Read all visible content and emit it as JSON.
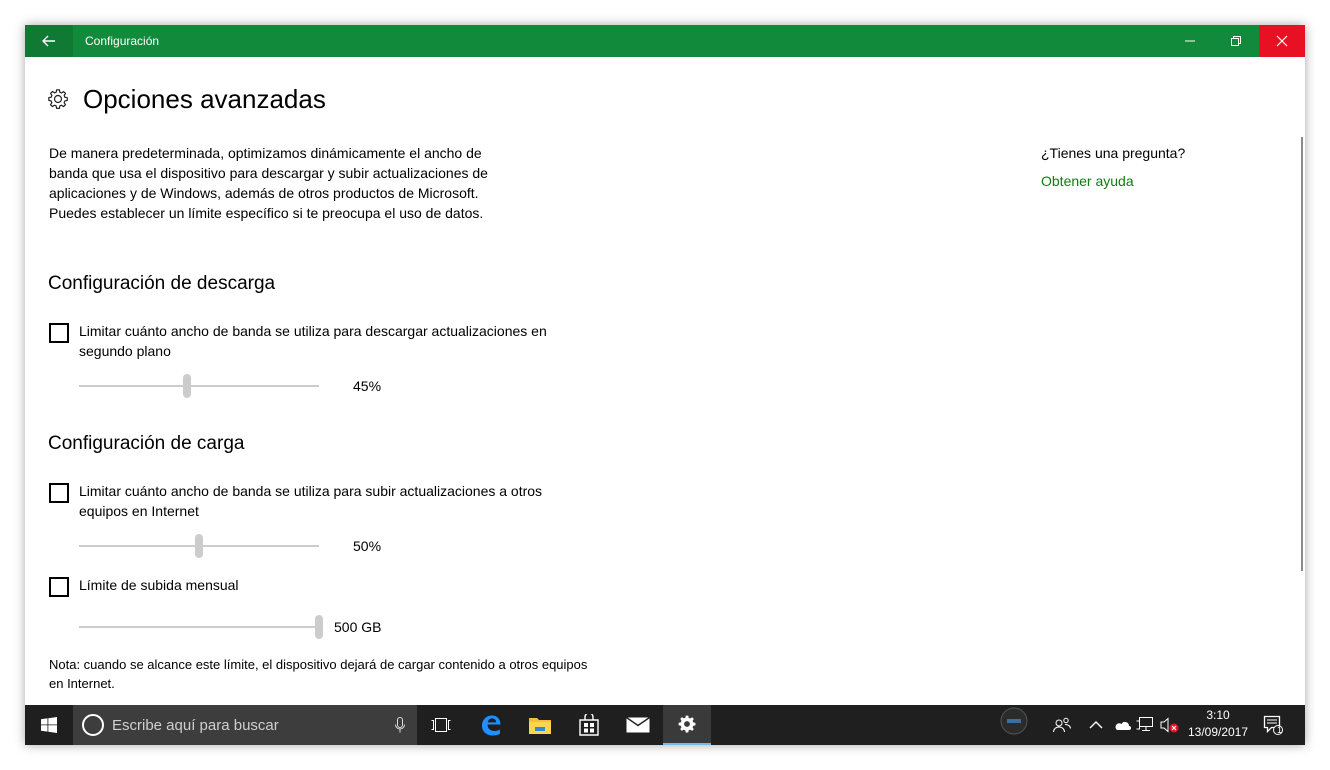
{
  "window": {
    "title": "Configuración",
    "accent_color": "#118a3c",
    "close_color": "#e81123"
  },
  "page": {
    "title": "Opciones avanzadas",
    "intro": "De manera predeterminada, optimizamos dinámicamente el ancho de banda que usa el dispositivo para descargar y subir actualizaciones de aplicaciones y de Windows, además de otros productos de Microsoft. Puedes establecer un límite específico si te preocupa el uso de datos."
  },
  "download": {
    "section_title": "Configuración de descarga",
    "checkbox_label": "Limitar cuánto ancho de banda se utiliza para descargar actualizaciones en segundo plano",
    "checked": false,
    "slider_value": "45%",
    "slider_fraction": 0.45
  },
  "upload": {
    "section_title": "Configuración de carga",
    "checkbox_label": "Limitar cuánto ancho de banda se utiliza para subir actualizaciones a otros equipos en Internet",
    "checked": false,
    "slider_value": "50%",
    "slider_fraction": 0.5,
    "monthly_label": "Límite de subida mensual",
    "monthly_checked": false,
    "monthly_value": "500 GB",
    "monthly_fraction": 1.0,
    "note": "Nota: cuando se alcance este límite, el dispositivo dejará de cargar contenido a otros equipos en Internet."
  },
  "sidebar": {
    "question": "¿Tienes una pregunta?",
    "help_link": "Obtener ayuda",
    "link_color": "#107c10"
  },
  "taskbar": {
    "search_placeholder": "Escribe aquí para buscar",
    "time": "3:10",
    "date": "13/09/2017",
    "notification_count": "1",
    "icons": [
      "windows-start-icon",
      "cortana-icon",
      "microphone-icon",
      "task-view-icon",
      "edge-icon",
      "file-explorer-icon",
      "store-icon",
      "mail-icon",
      "settings-icon",
      "people-icon",
      "chevron-up-icon",
      "onedrive-icon",
      "network-icon",
      "volume-muted-icon",
      "action-center-icon"
    ]
  }
}
